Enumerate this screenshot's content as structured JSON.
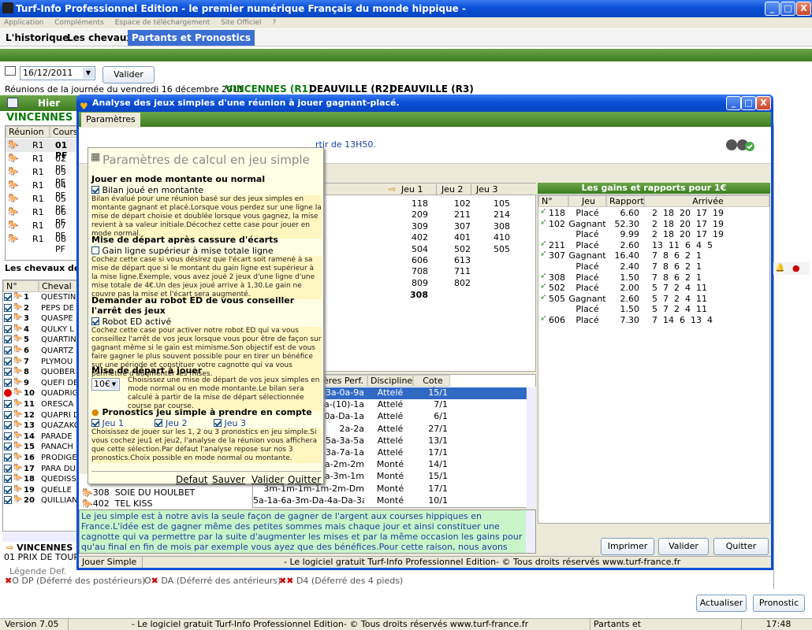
{
  "window": {
    "title": "Turf-Info Professionnel Edition - le premier numérique Français du monde hippique -",
    "min": "_",
    "max": "□",
    "close": "X"
  },
  "menu": [
    "Application",
    "Compléments",
    "Espace de téléchargement",
    "Site Officiel",
    "?"
  ],
  "tabs": [
    "L'historique",
    "Les chevaux",
    "Partants et Pronostics"
  ],
  "toolbar": {
    "date": "16/12/2011",
    "validate": "Valider",
    "reunions_label": "Réunions de la journée du vendredi 16 décembre 2011",
    "r1": "VINCENNES (R1)",
    "r2": "DEAUVILLE (R2)",
    "r3": "DEAUVILLE (R3)",
    "hier": "Hier"
  },
  "left": {
    "venue": "VINCENNES (R",
    "races_headers": [
      "Réunion",
      "Cours"
    ],
    "races": [
      {
        "r": "R1",
        "c": "01 PF"
      },
      {
        "r": "R1",
        "c": "02 PF"
      },
      {
        "r": "R1",
        "c": "03 PF"
      },
      {
        "r": "R1",
        "c": "04 PF"
      },
      {
        "r": "R1",
        "c": "05 PF"
      },
      {
        "r": "R1",
        "c": "06 PF"
      },
      {
        "r": "R1",
        "c": "07 PF"
      },
      {
        "r": "R1",
        "c": "08 PF"
      }
    ],
    "horses_title": "Les chevaux de la",
    "horse_headers": [
      "N°",
      "Cheval"
    ],
    "horses": [
      {
        "n": "1",
        "name": "QUESTIN"
      },
      {
        "n": "2",
        "name": "PEPS DE"
      },
      {
        "n": "3",
        "name": "QUASPE"
      },
      {
        "n": "4",
        "name": "QULKY L"
      },
      {
        "n": "5",
        "name": "QUARTIN"
      },
      {
        "n": "6",
        "name": "QUARTZ"
      },
      {
        "n": "7",
        "name": "PLYMOU"
      },
      {
        "n": "8",
        "name": "QUOBER"
      },
      {
        "n": "9",
        "name": "QUEFI DE"
      },
      {
        "n": "10",
        "name": "QUADRIG"
      },
      {
        "n": "11",
        "name": "ORESCA"
      },
      {
        "n": "12",
        "name": "QUAPRI D"
      },
      {
        "n": "13",
        "name": "QUAZAKC"
      },
      {
        "n": "14",
        "name": "PARADE"
      },
      {
        "n": "15",
        "name": "PANACH"
      },
      {
        "n": "16",
        "name": "PRODIGE"
      },
      {
        "n": "17",
        "name": "PARA DU"
      },
      {
        "n": "18",
        "name": "QUEDISS"
      },
      {
        "n": "19",
        "name": "QUELLE"
      },
      {
        "n": "20",
        "name": "QUILLIAN"
      }
    ],
    "bottom_venue": "VINCENNES (R",
    "bottom_race": "01 PRIX DE TOUR",
    "legend_title": "Légende Def.",
    "legend": [
      {
        "sym": "O",
        "t": "DP (Déferré des postérieurs)"
      },
      {
        "sym": "O",
        "t": "DA (Déferré des antérieurs)"
      },
      {
        "sym": "OO",
        "t": "D4 (Déferré des 4 pieds)"
      }
    ]
  },
  "right": {
    "actualiser": "Actualiser",
    "pronostic": "Pronostic"
  },
  "dialog": {
    "title": "Analyse des jeux simples d'une réunion à jouer gagnant-placé.",
    "tab": "Paramètres",
    "info_text": "rtir de 13H50.",
    "jeu_headers": [
      "Jeu 1",
      "Jeu 2",
      "Jeu 3"
    ],
    "jeu_rows": [
      [
        "118",
        "102",
        "105"
      ],
      [
        "209",
        "211",
        "214"
      ],
      [
        "309",
        "307",
        "308"
      ],
      [
        "402",
        "401",
        "410"
      ],
      [
        "504",
        "502",
        "505"
      ],
      [
        "606",
        "613",
        ""
      ],
      [
        "708",
        "711",
        ""
      ],
      [
        "809",
        "802",
        ""
      ]
    ],
    "jeu_total": "308",
    "gains_title": "Les gains et rapports pour 1€",
    "gains_headers": [
      "N°",
      "Jeu",
      "Rapport",
      "Arrivée"
    ],
    "gains": [
      {
        "n": "118",
        "jeu": "Placé",
        "r": "6.60",
        "a": "2  18  20  17  19"
      },
      {
        "n": "102",
        "jeu": "Gagnant",
        "r": "52.30",
        "a": "2  18  20  17  19"
      },
      {
        "n": "",
        "jeu": "Placé",
        "r": "9.99",
        "a": "2  18  20  17  19"
      },
      {
        "n": "211",
        "jeu": "Placé",
        "r": "2.60",
        "a": "13  11  6  4  5"
      },
      {
        "n": "307",
        "jeu": "Gagnant",
        "r": "16.40",
        "a": "7  8  6  2  1"
      },
      {
        "n": "",
        "jeu": "Placé",
        "r": "2.40",
        "a": "7  8  6  2  1"
      },
      {
        "n": "308",
        "jeu": "Placé",
        "r": "1.50",
        "a": "7  8  6  2  1"
      },
      {
        "n": "502",
        "jeu": "Placé",
        "r": "2.00",
        "a": "5  7  2  4  11"
      },
      {
        "n": "505",
        "jeu": "Gagnant",
        "r": "2.60",
        "a": "5  7  2  4  11"
      },
      {
        "n": "",
        "jeu": "Placé",
        "r": "1.50",
        "a": "5  7  2  4  11"
      },
      {
        "n": "606",
        "jeu": "Placé",
        "r": "7.30",
        "a": "7  14  6  13  4"
      }
    ],
    "perf_headers": [
      "nières Perf.",
      "Discipline",
      "Cote Réf."
    ],
    "perf": [
      {
        "p": "a-3a-0a-9a",
        "d": "Attelé",
        "c": "15/1"
      },
      {
        "p": "a-8a-(10)-1a",
        "d": "Attelé",
        "c": "7/1"
      },
      {
        "p": "a-0a-Da-1a",
        "d": "Attelé",
        "c": "6/1"
      },
      {
        "p": "2a-2a",
        "d": "Attelé",
        "c": "27/1"
      },
      {
        "p": "a-5a-3a-5a",
        "d": "Attelé",
        "c": "13/1"
      },
      {
        "p": "a-3a-7a-1a",
        "d": "Attelé",
        "c": "17/1"
      },
      {
        "p": "Da-2m-2m",
        "d": "Monté",
        "c": "14/1"
      },
      {
        "p": "-7a-3m-1m",
        "d": "Monté",
        "c": "15/1"
      },
      {
        "p": "3m-1m-1m-1m-2m-Dm",
        "d": "Monté",
        "c": "17/1"
      },
      {
        "p": "5a-1a-6a-3m-Da-4a-Da-3a",
        "d": "Monté",
        "c": "10/1"
      }
    ],
    "perf_horses": [
      {
        "n": "308",
        "name": "SOIE DU HOULBET"
      },
      {
        "n": "402",
        "name": "TEL KISS"
      }
    ],
    "params": {
      "title": "Paramètres de calcul en jeu simple",
      "s1_title": "Jouer en mode montante ou normal",
      "s1_opt": "Bilan joué en montante",
      "s1_desc": "Bilan évalué pour une réunion basé sur des jeux simples en montante gagnant et placé.Lorsque vous perdez sur une ligne la mise de départ choisie et doublée lorsque vous gagnez, la mise revient à sa valeur initiale.Décochez cette case pour jouer en mode normal.",
      "s2_title": "Mise de départ après cassure d'écarts",
      "s2_opt": "Gain ligne supérieur à mise totale ligne",
      "s2_desc": "Cochez cette case si vous désirez que l'écart soit ramené à sa mise de départ que si le montant du gain ligne est supérieur à la mise ligne.Exemple, vous avez joué 2 jeux d'une ligne d'une mise totale de 4€.Un des jeux joué arrive à 1,30.Le gain ne couvre pas la mise et l'écart sera augmenté.",
      "s3_title": "Demander au robot ED de vous conseiller l'arrêt des jeux",
      "s3_opt": "Robot ED activé",
      "s3_desc": "Cochez cette case pour activer notre robot ED qui va vous conseillez l'arrêt de vos jeux lorsque vous pour être de façon sur gagnant même si le gain est mimisme.Son objectif est de vous faire gagner le plus souvent possible pour en tirer un bénéfice sur une période et constituer votre cagnotte qui va vous permettre d'augmenter les mises.",
      "s4_title": "Mise de départ à jouer",
      "s4_value": "10€",
      "s4_desc": "Choisissez une mise de départ de vos jeux simples en mode normal ou en mode montante.Le bilan sera calculé à partir de la mise de départ sélectionnée course par course.",
      "s5_title": "Pronostics jeu simple à prendre en compte",
      "s5_j1": "Jeu 1",
      "s5_j2": "Jeu 2",
      "s5_j3": "Jeu 3",
      "s5_desc": "Choisissez de jouer sur les 1, 2 ou 3 pronostics en jeu simple.Si vous cochez jeu1 et jeu2, l'analyse de la réunion vous affichera que cette sélection.Par défaut l'analyse repose sur nos 3 pronostics.Choix possible en mode normal ou montante.",
      "defaut": "Defaut",
      "sauver": "Sauver",
      "valider": "Valider",
      "quitter": "Quitter"
    },
    "info_box": "Le jeu simple est à notre avis la seule façon de gagner de l'argent aux courses hippiques en France.L'idée est de gagner même des petites sommes mais chaque jour et ainsi constituer une cagnotte qui va permettre par la suite d'augmenter les mises et par la même occasion les gains pour qu'au final en fin de mois par exemple vous ayez que des bénéfices.Pour cette raison, nous avons mis au point cette solution qui va évoluer rapidement dans le temps à travers des nouvelles versions comme celle-ci.Notre analyse va vous proposer pour une course 1, 2 ou 3 chevaux à jouer en",
    "imprimer": "Imprimer",
    "valider": "Valider",
    "quitter": "Quitter",
    "status_left": "Jouer Simple",
    "status_right": "- Le logiciel gratuit Turf-Info Professionnel Edition- © Tous droits réservés www.turf-france.fr"
  },
  "statusbar": {
    "version": "Version 7.05",
    "center": "- Le logiciel gratuit Turf-Info Professionnel Edition- © Tous droits réservés www.turf-france.fr",
    "module": "Partants et Pronostics",
    "time": "17:48"
  }
}
